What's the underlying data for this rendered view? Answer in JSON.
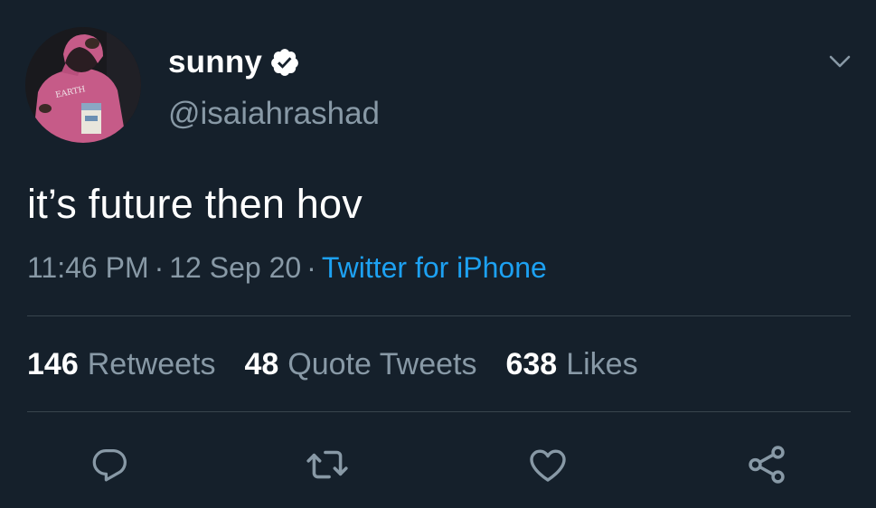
{
  "author": {
    "display_name": "sunny",
    "handle": "@isaiahrashad",
    "verified_icon": "verified-badge-icon",
    "avatar_shirt_text": "EARTH"
  },
  "tweet": {
    "text": "it’s future then hov",
    "time": "11:46 PM",
    "date": "12 Sep 20",
    "separator": "·",
    "source": "Twitter for iPhone"
  },
  "stats": {
    "retweets": {
      "count": "146",
      "label": "Retweets"
    },
    "quote_tweets": {
      "count": "48",
      "label": "Quote Tweets"
    },
    "likes": {
      "count": "638",
      "label": "Likes"
    }
  },
  "actions": [
    "reply-icon",
    "retweet-icon",
    "like-icon",
    "share-icon"
  ],
  "colors": {
    "background": "#15202b",
    "primary_text": "#ffffff",
    "secondary_text": "#8899a6",
    "link": "#1da1f2",
    "divider": "#38444d"
  }
}
